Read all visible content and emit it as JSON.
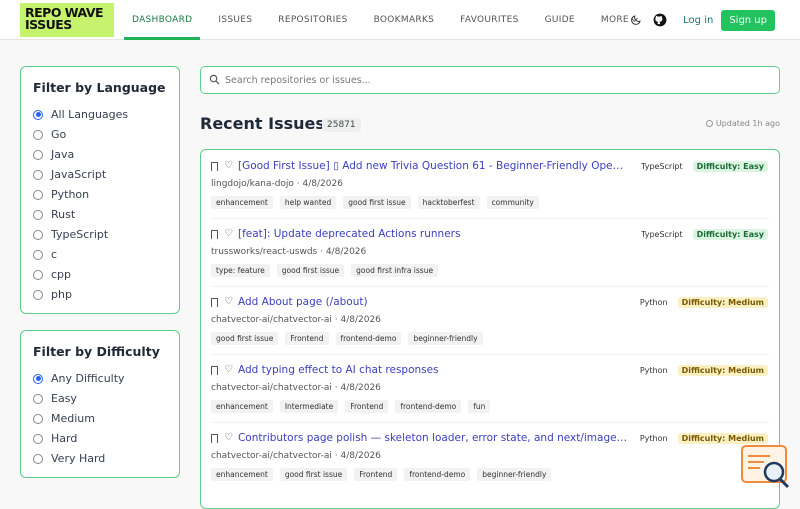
{
  "logo": {
    "line1": "REPO WAVE",
    "line2": "ISSUES"
  },
  "nav": [
    {
      "label": "DASHBOARD",
      "active": true
    },
    {
      "label": "ISSUES"
    },
    {
      "label": "REPOSITORIES"
    },
    {
      "label": "BOOKMARKS"
    },
    {
      "label": "FAVOURITES"
    },
    {
      "label": "GUIDE"
    },
    {
      "label": "MORE"
    }
  ],
  "header": {
    "login": "Log in",
    "signup": "Sign up"
  },
  "language_filter": {
    "title": "Filter by Language",
    "options": [
      "All Languages",
      "Go",
      "Java",
      "JavaScript",
      "Python",
      "Rust",
      "TypeScript",
      "c",
      "cpp",
      "php"
    ],
    "selected": "All Languages"
  },
  "difficulty_filter": {
    "title": "Filter by Difficulty",
    "options": [
      "Any Difficulty",
      "Easy",
      "Medium",
      "Hard",
      "Very Hard"
    ],
    "selected": "Any Difficulty"
  },
  "search": {
    "placeholder": "Search repositories or issues...",
    "value": ""
  },
  "recent": {
    "title": "Recent Issues",
    "count": "25871",
    "updated": "Updated 1h ago"
  },
  "issues": [
    {
      "title": "[Good First Issue] ▯ Add new Trivia Question 61 - Beginner-Friendly Open-so...",
      "meta": "lingdojo/kana-dojo · 4/8/2026",
      "tags": [
        "enhancement",
        "help wanted",
        "good first issue",
        "hacktoberfest",
        "community"
      ],
      "language": "TypeScript",
      "difficulty": "Difficulty: Easy",
      "level": "easy"
    },
    {
      "title": "[feat]: Update deprecated Actions runners",
      "meta": "trussworks/react-uswds · 4/8/2026",
      "tags": [
        "type: feature",
        "good first issue",
        "good first infra issue"
      ],
      "language": "TypeScript",
      "difficulty": "Difficulty: Easy",
      "level": "easy"
    },
    {
      "title": "Add About page (/about)",
      "meta": "chatvector-ai/chatvector-ai · 4/8/2026",
      "tags": [
        "good first issue",
        "Frontend",
        "frontend-demo",
        "beginner-friendly"
      ],
      "language": "Python",
      "difficulty": "Difficulty: Medium",
      "level": "medium"
    },
    {
      "title": "Add typing effect to AI chat responses",
      "meta": "chatvector-ai/chatvector-ai · 4/8/2026",
      "tags": [
        "enhancement",
        "Intermediate",
        "Frontend",
        "frontend-demo",
        "fun"
      ],
      "language": "Python",
      "difficulty": "Difficulty: Medium",
      "level": "medium"
    },
    {
      "title": "Contributors page polish — skeleton loader, error state, and next/image fix",
      "meta": "chatvector-ai/chatvector-ai · 4/8/2026",
      "tags": [
        "enhancement",
        "good first issue",
        "Frontend",
        "frontend-demo",
        "beginner-friendly"
      ],
      "language": "Python",
      "difficulty": "Difficulty: Medium",
      "level": "medium"
    }
  ]
}
